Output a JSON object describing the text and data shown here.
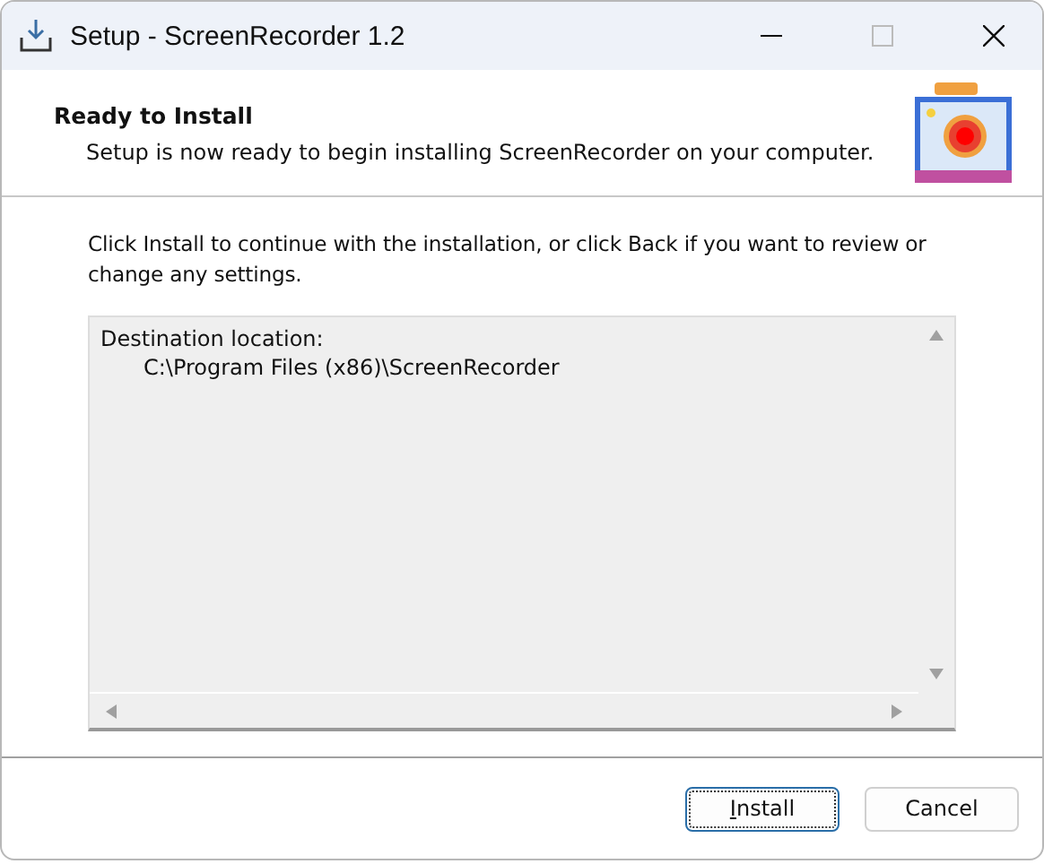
{
  "window": {
    "title": "Setup - ScreenRecorder 1.2"
  },
  "header": {
    "title": "Ready to Install",
    "subtitle": "Setup is now ready to begin installing ScreenRecorder on your computer."
  },
  "instructions": "Click Install to continue with the installation, or click Back if you want to review or change any settings.",
  "memo": {
    "lines": [
      {
        "text": "Destination location:",
        "indented": false
      },
      {
        "text": "C:\\Program Files (x86)\\ScreenRecorder",
        "indented": true
      }
    ]
  },
  "buttons": [
    {
      "label": "Install",
      "focused": true
    },
    {
      "label": "Cancel",
      "focused": false
    }
  ]
}
